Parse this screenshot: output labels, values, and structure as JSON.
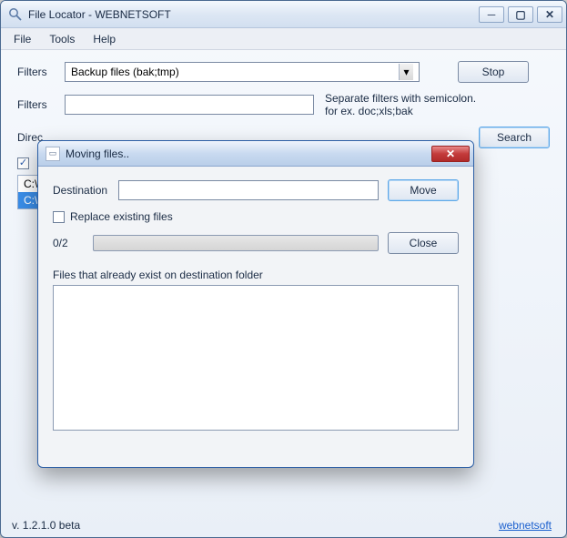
{
  "main": {
    "title": "File Locator - WEBNETSOFT",
    "menu": {
      "file": "File",
      "tools": "Tools",
      "help": "Help"
    },
    "labels": {
      "filters1": "Filters",
      "filters2": "Filters",
      "directory": "Direc",
      "hint_line1": "Separate filters with semicolon.",
      "hint_line2": "for ex. doc;xls;bak"
    },
    "filter_select": "Backup files (bak;tmp)",
    "filter_input": "",
    "checkbox_checked": true,
    "list": {
      "row0": "C:\\d",
      "row1": "C:\\"
    },
    "buttons": {
      "stop": "Stop",
      "search": "Search"
    },
    "footer": {
      "version": "v. 1.2.1.0 beta",
      "link": "webnetsoft"
    }
  },
  "dialog": {
    "title": "Moving files..",
    "labels": {
      "destination": "Destination",
      "replace": "Replace existing files",
      "files": "Files that already exist on destination folder"
    },
    "destination_value": "",
    "replace_checked": false,
    "progress_text": "0/2",
    "buttons": {
      "move": "Move",
      "close": "Close"
    }
  }
}
